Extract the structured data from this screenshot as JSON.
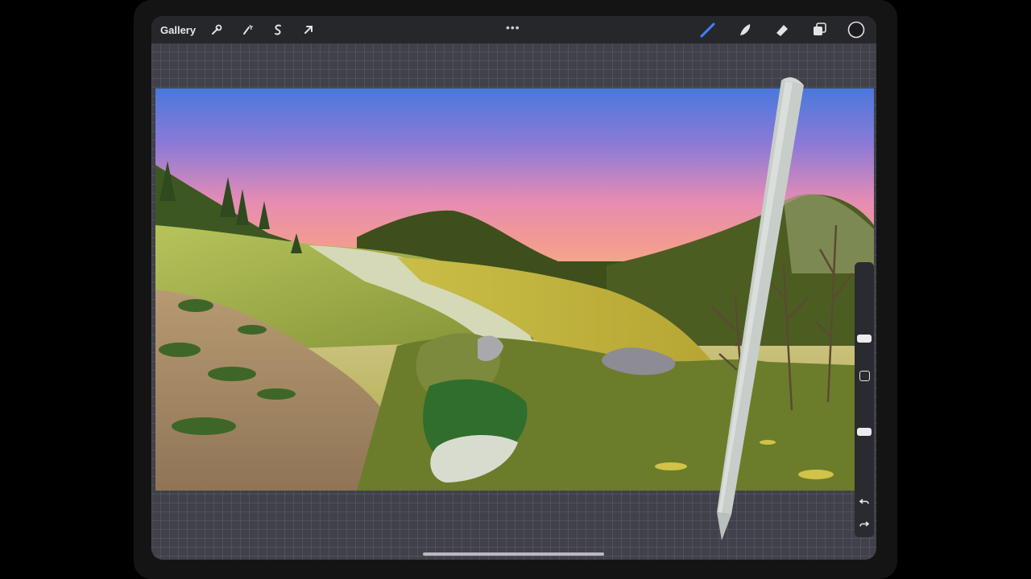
{
  "app": {
    "gallery_label": "Gallery",
    "menu_dots": "•••"
  },
  "toolbar": {
    "left_icons": [
      "wrench-icon",
      "magic-wand-icon",
      "selection-s-icon",
      "arrow-transform-icon"
    ],
    "right_icons": [
      "brush-icon",
      "smudge-icon",
      "eraser-icon",
      "layers-icon",
      "color-circle-icon"
    ],
    "accent_color": "#3a86ff"
  },
  "sidebar": {
    "icons": [
      "opacity-square-icon",
      "undo-icon",
      "redo-icon"
    ]
  },
  "canvas": {
    "description_colors": {
      "sky_top": "#4a78dc",
      "sky_pink": "#f29a92",
      "grass": "#a8a83d"
    }
  }
}
